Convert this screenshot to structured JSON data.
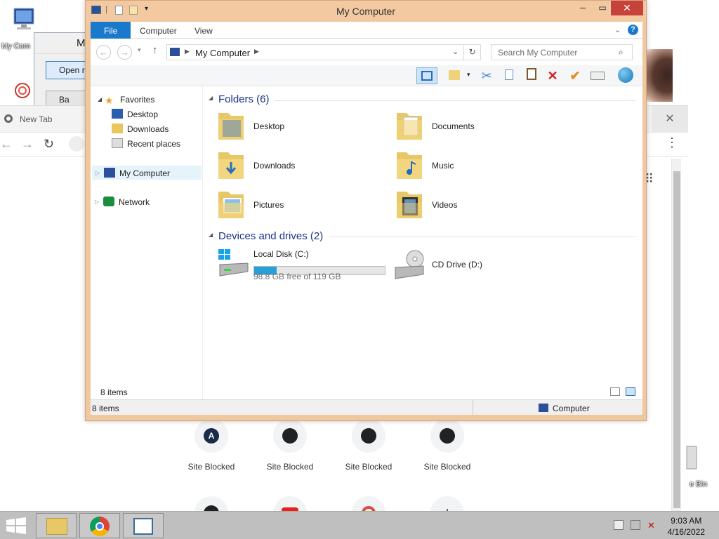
{
  "desktop": {
    "icons": [
      {
        "label": "My Com"
      },
      {
        "label": "e Bin"
      }
    ]
  },
  "bg_dialog": {
    "title_fragment": "M",
    "open_button": "Open ra",
    "second_button": "Ba"
  },
  "chrome": {
    "tab_title": "New Tab",
    "shortcuts": [
      {
        "label": "Site Blocked",
        "icon": "A"
      },
      {
        "label": "Site Blocked",
        "icon": "github-icon"
      },
      {
        "label": "Site Blocked",
        "icon": "github-icon"
      },
      {
        "label": "Site Blocked",
        "icon": "github-icon"
      }
    ]
  },
  "explorer": {
    "title": "My Computer",
    "ribbon_tabs": [
      "File",
      "Computer",
      "View"
    ],
    "address": "My Computer",
    "search_placeholder": "Search My Computer",
    "nav": {
      "favorites": "Favorites",
      "desktop": "Desktop",
      "downloads": "Downloads",
      "recent": "Recent places",
      "computer": "My Computer",
      "network": "Network"
    },
    "folders_header": "Folders (6)",
    "folders": [
      {
        "name": "Desktop"
      },
      {
        "name": "Documents"
      },
      {
        "name": "Downloads"
      },
      {
        "name": "Music"
      },
      {
        "name": "Pictures"
      },
      {
        "name": "Videos"
      }
    ],
    "devices_header": "Devices and drives (2)",
    "drives": [
      {
        "name": "Local Disk (C:)",
        "free": "98.8 GB free of 119 GB",
        "used_fraction": 0.17
      },
      {
        "name": "CD Drive (D:)"
      }
    ],
    "item_count_inner": "8 items",
    "status": {
      "items": "8 items",
      "location": "Computer"
    }
  },
  "taskbar": {
    "time": "9:03 AM",
    "date": "4/16/2022"
  }
}
